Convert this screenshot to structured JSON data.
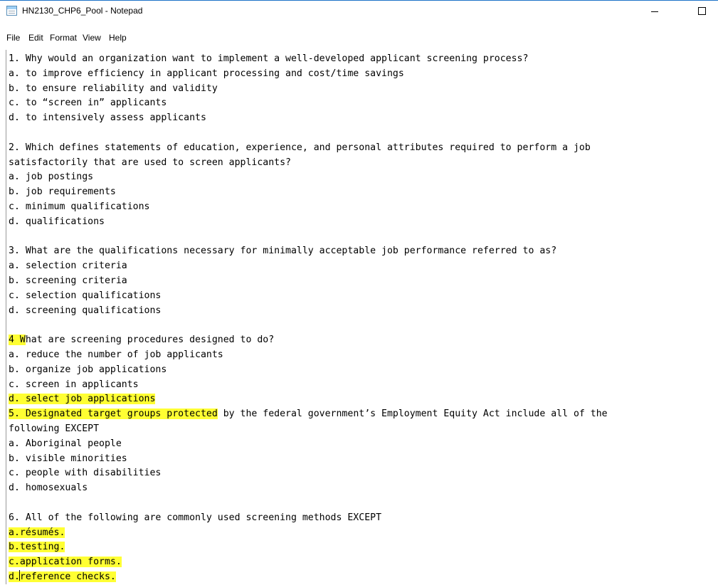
{
  "window": {
    "title": "HN2130_CHP6_Pool - Notepad"
  },
  "menu": [
    "File",
    "Edit",
    "Format",
    "View",
    "Help"
  ],
  "lines": [
    {
      "segments": [
        {
          "text": "1. Why would an organization want to implement a well-developed applicant screening process?",
          "hl": false
        }
      ]
    },
    {
      "segments": [
        {
          "text": "a. to improve efficiency in applicant processing and cost/time savings",
          "hl": false
        }
      ]
    },
    {
      "segments": [
        {
          "text": "b. to ensure reliability and validity",
          "hl": false
        }
      ]
    },
    {
      "segments": [
        {
          "text": "c. to “screen in” applicants",
          "hl": false
        }
      ]
    },
    {
      "segments": [
        {
          "text": "d. to intensively assess applicants",
          "hl": false
        }
      ]
    },
    {
      "segments": []
    },
    {
      "segments": [
        {
          "text": "2. Which defines statements of education, experience, and personal attributes required to perform a job",
          "hl": false
        }
      ]
    },
    {
      "segments": [
        {
          "text": "satisfactorily that are used to screen applicants?",
          "hl": false
        }
      ]
    },
    {
      "segments": [
        {
          "text": "a. job postings",
          "hl": false
        }
      ]
    },
    {
      "segments": [
        {
          "text": "b. job requirements",
          "hl": false
        }
      ]
    },
    {
      "segments": [
        {
          "text": "c. minimum qualifications",
          "hl": false
        }
      ]
    },
    {
      "segments": [
        {
          "text": "d. qualifications",
          "hl": false
        }
      ]
    },
    {
      "segments": []
    },
    {
      "segments": [
        {
          "text": "3. What are the qualifications necessary for minimally acceptable job performance referred to as?",
          "hl": false
        }
      ]
    },
    {
      "segments": [
        {
          "text": "a. selection criteria",
          "hl": false
        }
      ]
    },
    {
      "segments": [
        {
          "text": "b. screening criteria",
          "hl": false
        }
      ]
    },
    {
      "segments": [
        {
          "text": "c. selection qualifications",
          "hl": false
        }
      ]
    },
    {
      "segments": [
        {
          "text": "d. screening qualifications",
          "hl": false
        }
      ]
    },
    {
      "segments": []
    },
    {
      "segments": [
        {
          "text": "4 W",
          "hl": true
        },
        {
          "text": "hat are screening procedures designed to do?",
          "hl": false
        }
      ]
    },
    {
      "segments": [
        {
          "text": "a. reduce the number of job applicants",
          "hl": false
        }
      ]
    },
    {
      "segments": [
        {
          "text": "b. organize job applications",
          "hl": false
        }
      ]
    },
    {
      "segments": [
        {
          "text": "c. screen in applicants",
          "hl": false
        }
      ]
    },
    {
      "segments": [
        {
          "text": "d. select job applications",
          "hl": true
        }
      ]
    },
    {
      "segments": [
        {
          "text": "5. Designated target groups protected",
          "hl": true
        },
        {
          "text": " by the federal government’s Employment Equity Act include all of the",
          "hl": false
        }
      ]
    },
    {
      "segments": [
        {
          "text": "following EXCEPT",
          "hl": false
        }
      ]
    },
    {
      "segments": [
        {
          "text": "a. Aboriginal people",
          "hl": false
        }
      ]
    },
    {
      "segments": [
        {
          "text": "b. visible minorities",
          "hl": false
        }
      ]
    },
    {
      "segments": [
        {
          "text": "c. people with disabilities",
          "hl": false
        }
      ]
    },
    {
      "segments": [
        {
          "text": "d. homosexuals",
          "hl": false
        }
      ]
    },
    {
      "segments": []
    },
    {
      "segments": [
        {
          "text": "6. All of the following are commonly used screening methods EXCEPT",
          "hl": false
        }
      ]
    },
    {
      "segments": [
        {
          "text": "a.résumés.",
          "hl": true
        }
      ]
    },
    {
      "segments": [
        {
          "text": "b.testing.",
          "hl": true
        }
      ]
    },
    {
      "segments": [
        {
          "text": "c.application forms.",
          "hl": true
        }
      ]
    },
    {
      "segments": [
        {
          "text": "d.",
          "hl": true
        },
        {
          "caret": true
        },
        {
          "text": "reference checks.",
          "hl": true
        }
      ]
    }
  ]
}
